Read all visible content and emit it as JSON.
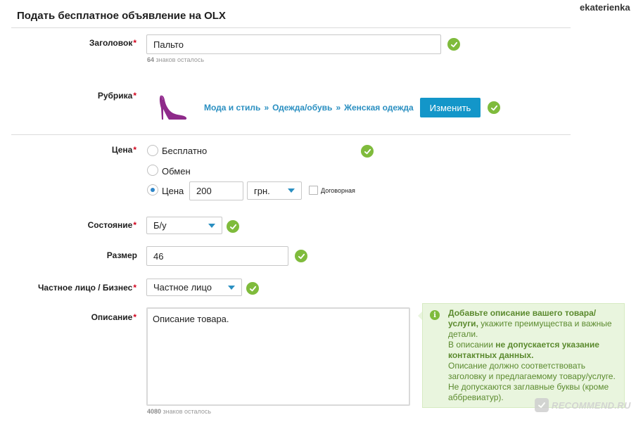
{
  "header": {
    "title": "Подать бесплатное объявление на OLX",
    "username": "ekaterienka"
  },
  "form": {
    "title_field": {
      "label": "Заголовок",
      "value": "Пальто",
      "counter_number": "64",
      "counter_text": "знаков осталось"
    },
    "category": {
      "label": "Рубрика",
      "icon": "high-heel-shoe-icon",
      "breadcrumb": [
        "Мода и стиль",
        "Одежда/обувь",
        "Женская одежда"
      ],
      "separator": "»",
      "change_button": "Изменить"
    },
    "price": {
      "label": "Цена",
      "options": [
        {
          "label": "Бесплатно",
          "selected": false
        },
        {
          "label": "Обмен",
          "selected": false
        },
        {
          "label": "Цена",
          "selected": true
        }
      ],
      "amount": "200",
      "currency": "грн.",
      "negotiable_label": "Договорная",
      "negotiable_checked": false
    },
    "condition": {
      "label": "Состояние",
      "value": "Б/у"
    },
    "size": {
      "label": "Размер",
      "value": "46"
    },
    "seller_type": {
      "label": "Частное лицо / Бизнес",
      "value": "Частное лицо"
    },
    "description": {
      "label": "Описание",
      "value": "Описание товара.",
      "counter_number": "4080",
      "counter_text": "знаков осталось"
    },
    "required_mark": "*"
  },
  "hint": {
    "line1_bold": "Добавьте описание вашего товара/услуги,",
    "line1_rest": " укажите преимущества и важные детали.",
    "line2_pre": "В описании ",
    "line2_bold": "не допускается указание контактных данных.",
    "line3": "Описание должно соответствовать заголовку и предлагаемому товару/услуге.",
    "line4": "Не допускаются заглавные буквы (кроме аббревиатур)."
  },
  "watermark": {
    "text": "RECOMMEND.RU"
  },
  "colors": {
    "accent_blue": "#1396c9",
    "link_blue": "#2a8fc1",
    "success_green": "#7fbb3c",
    "required_red": "#d0021b",
    "shoe_purple": "#8e2a8a"
  }
}
